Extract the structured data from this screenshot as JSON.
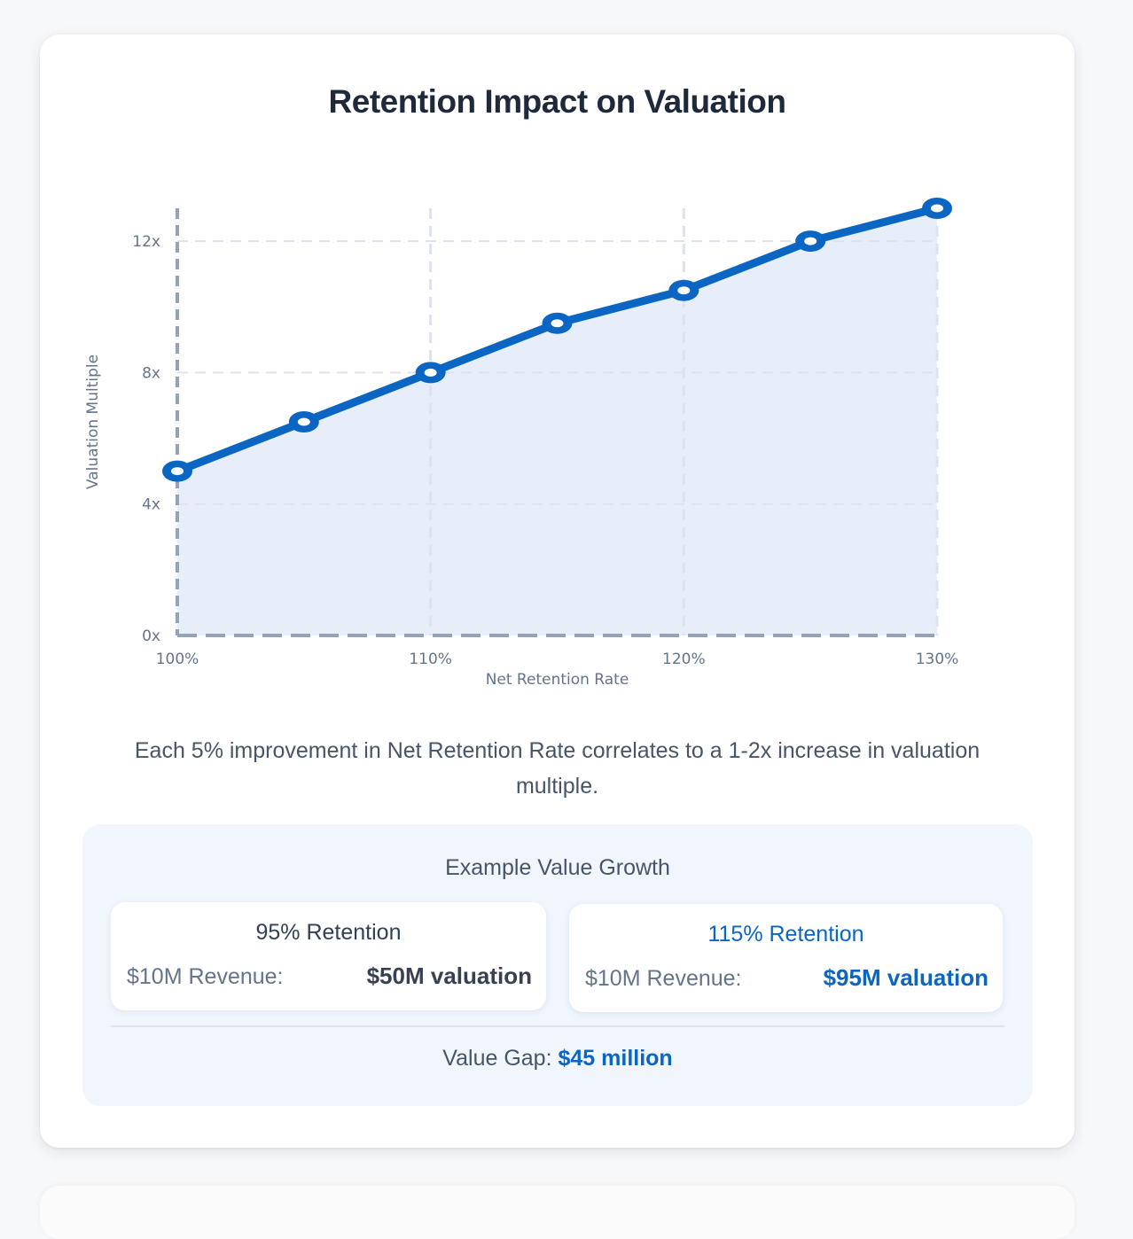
{
  "title": "Retention Impact on Valuation",
  "chart_data": {
    "type": "area",
    "title": "Retention Impact on Valuation",
    "xlabel": "Net Retention Rate",
    "ylabel": "Valuation Multiple",
    "x": [
      100,
      105,
      110,
      115,
      120,
      125,
      130
    ],
    "series": [
      {
        "values": [
          5,
          6.5,
          8,
          9.5,
          10.5,
          12,
          13
        ]
      }
    ],
    "xlim": [
      100,
      130
    ],
    "ylim": [
      0,
      13
    ],
    "x_ticks": [
      100,
      110,
      120,
      130
    ],
    "x_tick_labels": [
      "100%",
      "110%",
      "120%",
      "130%"
    ],
    "y_ticks": [
      0,
      4,
      8,
      12
    ],
    "y_tick_labels": [
      "0x",
      "4x",
      "8x",
      "12x"
    ],
    "grid": true,
    "legend": "none",
    "line_color": "#0a66c2",
    "fill_color": "#e8eef9"
  },
  "caption": "Each 5% improvement in Net Retention Rate correlates to a 1-2x increase in valuation multiple.",
  "example": {
    "title": "Example Value Growth",
    "scenarios": [
      {
        "title": "95% Retention",
        "revenue_label": "$10M Revenue:",
        "valuation": "$50M valuation"
      },
      {
        "title": "115% Retention",
        "revenue_label": "$10M Revenue:",
        "valuation": "$95M valuation"
      }
    ],
    "gap_label": "Value Gap:",
    "gap_value": "$45 million"
  },
  "colors": {
    "accent": "#0a66c2",
    "heading": "#1e293b",
    "muted": "#64748b"
  }
}
